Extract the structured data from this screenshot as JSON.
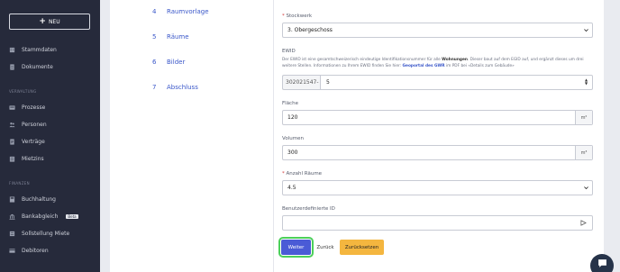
{
  "sidebar": {
    "new_label": "NEU",
    "items": [
      {
        "label": "Stammdaten",
        "icon": "building-icon"
      },
      {
        "label": "Dokumente",
        "icon": "document-icon"
      }
    ],
    "section_verwaltung": "VERWALTUNG",
    "verwaltung_items": [
      {
        "label": "Prozesse",
        "icon": "process-icon"
      },
      {
        "label": "Personen",
        "icon": "people-icon"
      },
      {
        "label": "Verträge",
        "icon": "contract-icon"
      },
      {
        "label": "Mietzins",
        "icon": "rent-icon"
      }
    ],
    "section_finanzen": "FINANZEN",
    "finanzen_items": [
      {
        "label": "Buchhaltung",
        "icon": "ledger-icon"
      },
      {
        "label": "Bankabgleich",
        "icon": "bank-icon",
        "badge": "Beta"
      },
      {
        "label": "Sollstellung Miete",
        "icon": "list-icon"
      },
      {
        "label": "Debitoren",
        "icon": "debtor-icon"
      }
    ]
  },
  "steps": [
    {
      "num": "4",
      "label": "Raumvorlage"
    },
    {
      "num": "5",
      "label": "Räume"
    },
    {
      "num": "6",
      "label": "Bilder"
    },
    {
      "num": "7",
      "label": "Abschluss"
    }
  ],
  "form": {
    "stockwerk_label": "Stockwerk",
    "stockwerk_value": "3. Obergeschoss",
    "ewid_label": "EWID",
    "ewid_help_pre": "Der EWID ist eine gesamtschweizerisch eindeutige Identifikationsnummer für alle ",
    "ewid_help_bold": "Wohnungen",
    "ewid_help_mid": ". Dieser baut auf dem EGID auf, und ergänzt dieses um drei weitere Stellen. Informationen zu Ihrem EWID finden Sie hier: ",
    "ewid_help_link": "Geoportal des GWR",
    "ewid_help_post": " im PDF bei «Details zum Gebäude»",
    "ewid_prefix": "302021547-",
    "ewid_value": "5",
    "flaeche_label": "Fläche",
    "flaeche_value": "120",
    "flaeche_unit": "m²",
    "volumen_label": "Volumen",
    "volumen_value": "300",
    "volumen_unit": "m³",
    "raeume_label": "Anzahl Räume",
    "raeume_value": "4.5",
    "custom_id_label": "Benutzerdefinierte ID",
    "custom_id_value": ""
  },
  "buttons": {
    "next": "Weiter",
    "back": "Zurück",
    "reset": "Zurücksetzen"
  },
  "colors": {
    "sidebar_bg": "#262a3b",
    "accent": "#4a5bd6",
    "reset": "#f4b63f",
    "focus": "#4cd05a"
  }
}
